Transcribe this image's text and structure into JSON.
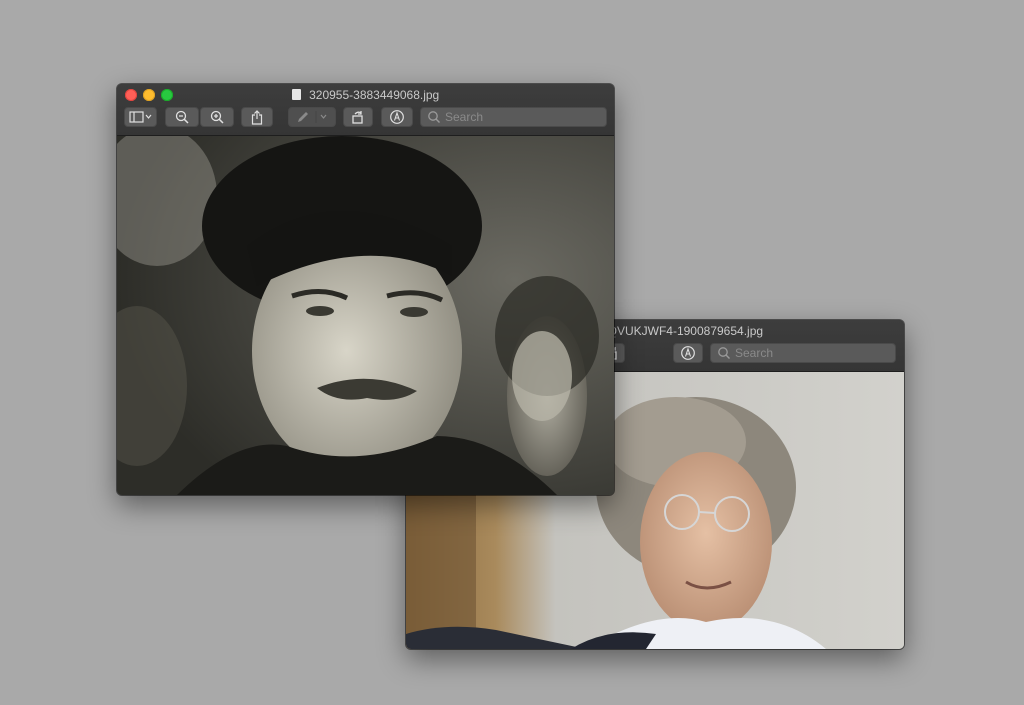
{
  "back_window": {
    "title": "3IO4RCQVUKJWF4-1900879654.jpg",
    "search_placeholder": "Search",
    "image_alt": "Color photograph of a man with curly grey hair and glasses"
  },
  "front_window": {
    "title": "320955-3883449068.jpg",
    "search_placeholder": "Search",
    "image_alt": "Black-and-white photograph of a man with dark tousled hair and a moustache"
  },
  "icons": {
    "sidebar": "sidebar-icon",
    "zoom_out": "zoom-out-icon",
    "zoom_in": "zoom-in-icon",
    "share": "share-icon",
    "markup": "pen-icon",
    "rotate": "rotate-icon",
    "annotate": "markup-icon",
    "search": "search-icon"
  },
  "colors": {
    "desktop": "#a9a9a9",
    "close": "#ff5f57",
    "minimize": "#febc2e",
    "maximize": "#28c840"
  }
}
